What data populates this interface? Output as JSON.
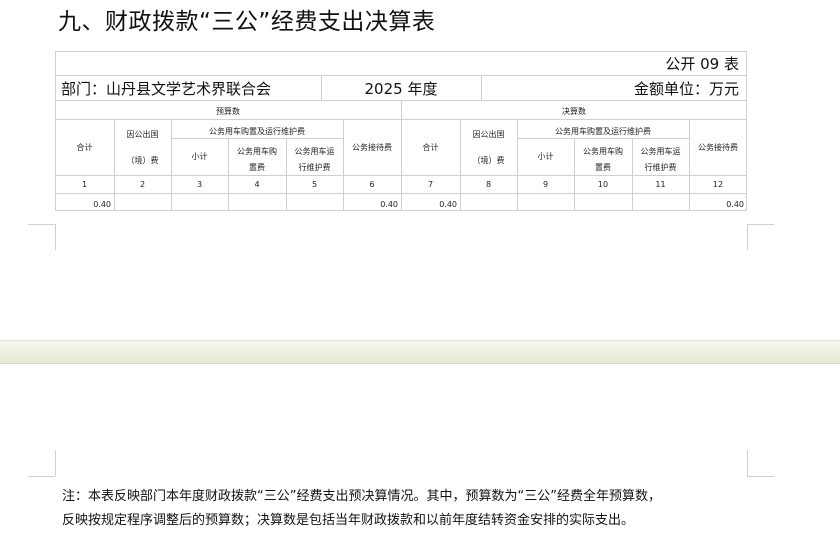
{
  "title": "九、财政拨款“三公”经费支出决算表",
  "table_no": "公开 09 表",
  "department": "部门：山丹县文学艺术界联合会",
  "year": "2025 年度",
  "unit": "金额单位：万元",
  "groups": {
    "budget": "预算数",
    "actual": "决算数"
  },
  "headers": {
    "total": "合计",
    "abroad_line1": "因公出国",
    "abroad_line2": "（境）费",
    "vehicle_group": "公务用车购置及运行维护费",
    "subtotal": "小计",
    "vehicle_purchase": "公务用车购置费",
    "vehicle_operation": "公务用车运行维护费",
    "reception": "公务接待费"
  },
  "column_numbers": [
    "1",
    "2",
    "3",
    "4",
    "5",
    "6",
    "7",
    "8",
    "9",
    "10",
    "11",
    "12"
  ],
  "row_values": [
    "0.40",
    "",
    "",
    "",
    "",
    "0.40",
    "0.40",
    "",
    "",
    "",
    "",
    "0.40"
  ],
  "note_line1": "注：本表反映部门本年度财政拨款“三公”经费支出预决算情况。其中，预算数为“三公”经费全年预算数，",
  "note_line2": "反映按规定程序调整后的预算数；决算数是包括当年财政拨款和以前年度结转资金安排的实际支出。"
}
